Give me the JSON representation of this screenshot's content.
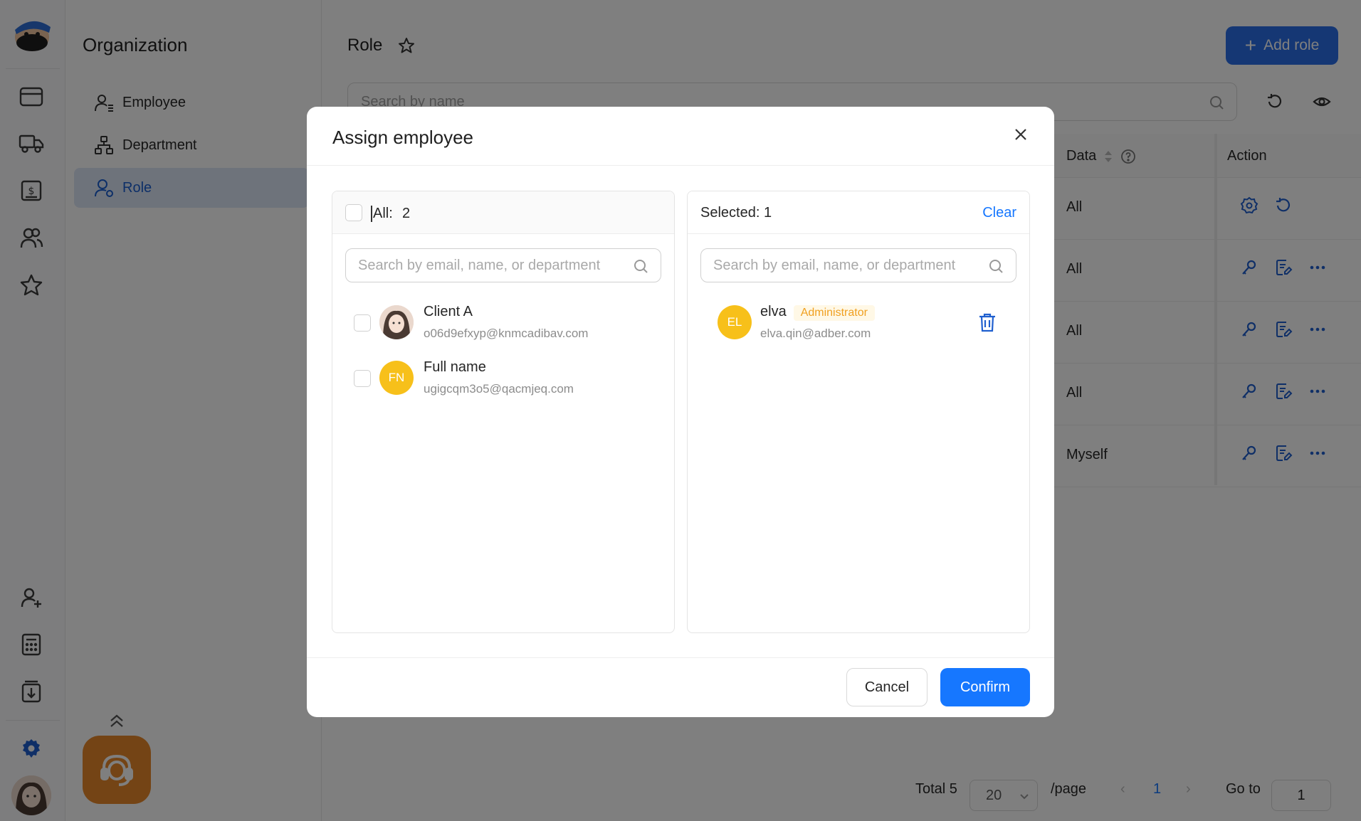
{
  "nav": {
    "title": "Organization",
    "items": [
      {
        "label": "Employee",
        "icon": "user-icon"
      },
      {
        "label": "Department",
        "icon": "org-chart-icon"
      },
      {
        "label": "Role",
        "icon": "role-icon"
      }
    ]
  },
  "page": {
    "title": "Role",
    "add_button": "Add role",
    "search_placeholder": "Search by name"
  },
  "table": {
    "headers": {
      "data": "Data",
      "action": "Action"
    },
    "rows": [
      {
        "data": "All"
      },
      {
        "data": "All"
      },
      {
        "data": "All"
      },
      {
        "data": "All"
      },
      {
        "data": "Myself"
      }
    ]
  },
  "pagination": {
    "total": "Total 5",
    "page_size": "20",
    "per_page": "/page",
    "current": "1",
    "goto_label": "Go to",
    "goto_value": "1"
  },
  "modal": {
    "title": "Assign employee",
    "left": {
      "all_label": "All:",
      "all_count": "2",
      "search_placeholder": "Search by email, name, or department",
      "people": [
        {
          "name": "Client A",
          "email": "o06d9efxyp@knmcadibav.com"
        },
        {
          "name": "Full name",
          "email": "ugigcqm3o5@qacmjeq.com",
          "initials": "FN"
        }
      ]
    },
    "right": {
      "selected_label": "Selected: 1",
      "clear_label": "Clear",
      "search_placeholder": "Search by email, name, or department",
      "people": [
        {
          "name": "elva",
          "tag": "Administrator",
          "email": "elva.qin@adber.com",
          "initials": "EL"
        }
      ]
    },
    "cancel_label": "Cancel",
    "confirm_label": "Confirm"
  },
  "colors": {
    "primary": "#1677ff",
    "nav_active_bg": "#dde7f7",
    "avatar_yellow": "#f7c01a",
    "support_orange": "#e8892b",
    "tag_text": "#f0a020"
  }
}
